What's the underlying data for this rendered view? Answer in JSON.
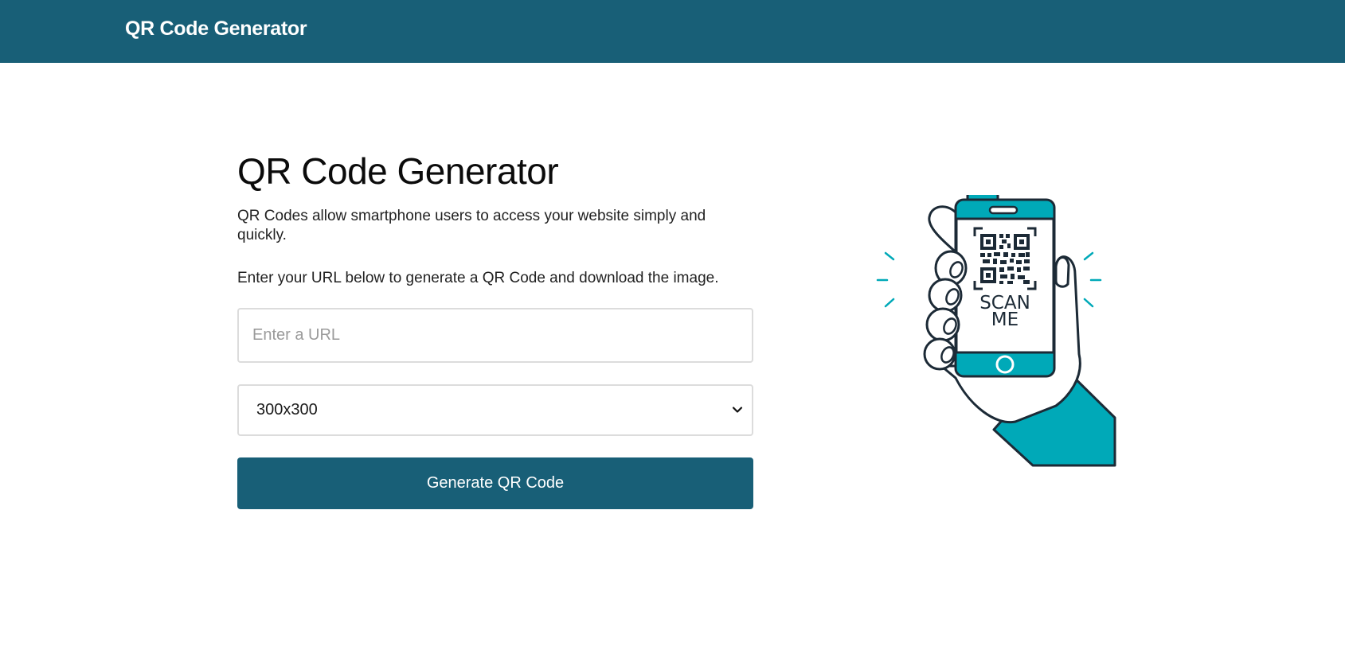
{
  "header": {
    "brand": "QR Code Generator"
  },
  "main": {
    "title": "QR Code Generator",
    "intro": "QR Codes allow smartphone users to access your website simply and quickly.",
    "instruction": "Enter your URL below to generate a QR Code and download the image.",
    "url_placeholder": "Enter a URL",
    "url_value": "",
    "size_selected": "300x300",
    "generate_label": "Generate QR Code"
  },
  "illustration": {
    "line1": "SCAN",
    "line2": "ME"
  },
  "colors": {
    "brand": "#185f77",
    "accent": "#00a9b8"
  },
  "icons": {
    "select_caret": "chevron-down-icon",
    "illustration": "hand-holding-phone-qr-illustration"
  }
}
